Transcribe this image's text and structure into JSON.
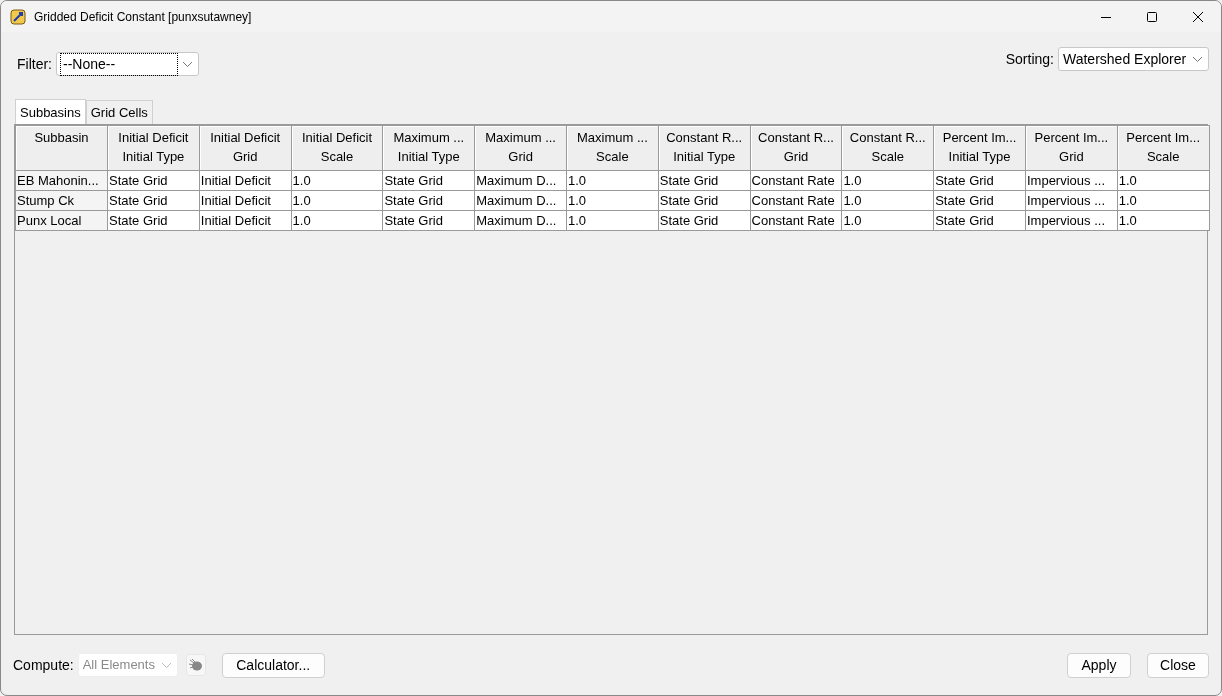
{
  "window": {
    "title": "Gridded Deficit Constant [punxsutawney]"
  },
  "filter": {
    "label": "Filter:",
    "value": "--None--"
  },
  "sorting": {
    "label": "Sorting:",
    "value": "Watershed Explorer"
  },
  "tabs": [
    {
      "label": "Subbasins",
      "selected": true
    },
    {
      "label": "Grid Cells",
      "selected": false
    }
  ],
  "table": {
    "columns": [
      "Subbasin",
      "Initial Deficit\nInitial Type",
      "Initial Deficit\nGrid",
      "Initial Deficit\nScale",
      "Maximum ...\nInitial Type",
      "Maximum ...\nGrid",
      "Maximum ...\nScale",
      "Constant R...\nInitial Type",
      "Constant R...\nGrid",
      "Constant R...\nScale",
      "Percent Im...\nInitial Type",
      "Percent Im...\nGrid",
      "Percent Im...\nScale"
    ],
    "rows": [
      [
        "EB Mahonin...",
        "State Grid",
        "Initial Deficit",
        "1.0",
        "State Grid",
        "Maximum D...",
        "1.0",
        "State Grid",
        "Constant Rate",
        "1.0",
        "State Grid",
        "Impervious ...",
        "1.0"
      ],
      [
        "Stump Ck",
        "State Grid",
        "Initial Deficit",
        "1.0",
        "State Grid",
        "Maximum D...",
        "1.0",
        "State Grid",
        "Constant Rate",
        "1.0",
        "State Grid",
        "Impervious ...",
        "1.0"
      ],
      [
        "Punx Local",
        "State Grid",
        "Initial Deficit",
        "1.0",
        "State Grid",
        "Maximum D...",
        "1.0",
        "State Grid",
        "Constant Rate",
        "1.0",
        "State Grid",
        "Impervious ...",
        "1.0"
      ]
    ]
  },
  "compute": {
    "label": "Compute:",
    "value": "All Elements",
    "disabled": true
  },
  "buttons": {
    "calculator": "Calculator...",
    "apply": "Apply",
    "close": "Close"
  }
}
